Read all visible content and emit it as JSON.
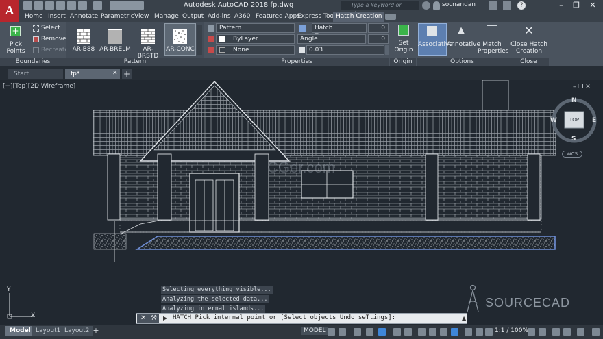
{
  "app": {
    "logo_letter": "A",
    "title": "Autodesk AutoCAD 2018   fp.dwg",
    "search_placeholder": "Type a keyword or phrase",
    "user": "socnandan"
  },
  "ribbon_tabs": [
    "Home",
    "Insert",
    "Annotate",
    "Parametric",
    "View",
    "Manage",
    "Output",
    "Add-ins",
    "A360",
    "Featured Apps",
    "Express Tools",
    "Hatch Creation"
  ],
  "ribbon": {
    "boundaries": {
      "pick_points": "Pick Points",
      "select": "Select",
      "remove": "Remove",
      "recreate": "Recreate",
      "panel_label": "Boundaries"
    },
    "pattern": {
      "items": [
        "AR-B88",
        "AR-BRELM",
        "AR-BRSTD",
        "AR-CONC"
      ],
      "panel_label": "Pattern"
    },
    "properties": {
      "type": "Pattern",
      "color": "ByLayer",
      "background": "None",
      "transparency_label": "Hatch Transparency",
      "transparency_value": "0",
      "angle_label": "Angle",
      "angle_value": "0",
      "scale_value": "0.03",
      "panel_label": "Properties"
    },
    "origin": {
      "set_origin": "Set Origin",
      "panel_label": "Origin"
    },
    "options": {
      "associative": "Associative",
      "annotative": "Annotative",
      "match_properties": "Match Properties",
      "panel_label": "Options"
    },
    "close": {
      "label": "Close Hatch Creation",
      "panel_label": "Close"
    }
  },
  "doc_tabs": [
    "Start",
    "fp*"
  ],
  "viewport_label": "[−][Top][2D Wireframe]",
  "viewcube": {
    "top": "TOP",
    "north": "N",
    "south": "S",
    "east": "E",
    "west": "W",
    "wcs": "WCS"
  },
  "ucs": {
    "x": "X",
    "y": "Y"
  },
  "command": {
    "history": [
      "Selecting everything visible...",
      "Analyzing the selected data...",
      "Analyzing internal islands..."
    ],
    "prompt": "HATCH Pick internal point or [Select objects Undo seTtings]:"
  },
  "layout_tabs": [
    "Model",
    "Layout1",
    "Layout2"
  ],
  "status": {
    "model": "MODEL",
    "scale": "1:1 / 100%"
  },
  "watermarks": {
    "sourcecad": "SOURCECAD",
    "cg": "CGer.com"
  },
  "colors": {
    "accent": "#586270",
    "logo": "#b8262d",
    "drawing_bg": "#212830",
    "hatch_border": "#6f8fd8"
  }
}
